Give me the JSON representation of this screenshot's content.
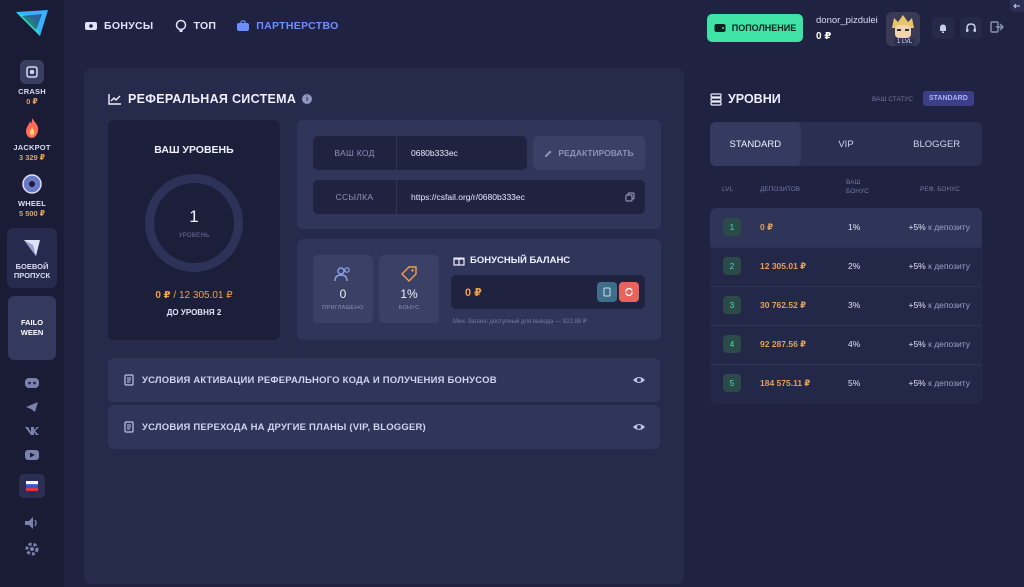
{
  "sidebar": {
    "games": [
      {
        "name": "CRASH",
        "value": "0 ₽"
      },
      {
        "name": "JACKPOT",
        "value": "3 329 ₽"
      },
      {
        "name": "WHEEL",
        "value": "5 500 ₽"
      }
    ],
    "battle_pass": "БОЕВОЙ ПРОПУСК",
    "event_line1": "FAILO",
    "event_line2": "WEEN",
    "socials": [
      "discord-icon",
      "telegram-icon",
      "vk-icon",
      "youtube-icon"
    ]
  },
  "topbar": {
    "nav": [
      {
        "label": "БОНУСЫ",
        "icon": "ticket-icon"
      },
      {
        "label": "ТОП",
        "icon": "trophy-icon"
      },
      {
        "label": "ПАРТНЕРСТВО",
        "icon": "briefcase-icon"
      }
    ],
    "deposit_label": "ПОПОЛНЕНИЕ",
    "username": "donor_pizdulei",
    "balance": "0 ₽",
    "avatar_level": "1 LVL"
  },
  "referral": {
    "title": "РЕФЕРАЛЬНАЯ СИСТЕМА",
    "your_level_title": "ВАШ УРОВЕНЬ",
    "level": "1",
    "level_label": "УРОВЕНЬ",
    "progress_current": "0 ₽",
    "progress_sep": " / ",
    "progress_target": "12 305.01 ₽",
    "next_level": "ДО УРОВНЯ 2",
    "code_label": "ВАШ КОД",
    "code_value": "0680b333ec",
    "edit_label": "РЕДАКТИРОВАТЬ",
    "link_label": "ССЫЛКА",
    "link_value": "https://csfail.org/r/0680b333ec",
    "invited_value": "0",
    "invited_label": "ПРИГЛАШЕНО",
    "bonus_pct_value": "1%",
    "bonus_pct_label": "БОНУС",
    "bonus_balance_title": "БОНУСНЫЙ БАЛАНС",
    "bonus_balance": "0 ₽",
    "bonus_note": "Мин. баланс доступный для вывода — 922.88 ₽",
    "accordion_1": "УСЛОВИЯ АКТИВАЦИИ РЕФЕРАЛЬНОГО КОДА И ПОЛУЧЕНИЯ БОНУСОВ",
    "accordion_2": "УСЛОВИЯ ПЕРЕХОДА НА ДРУГИЕ ПЛАНЫ (VIP, BLOGGER)"
  },
  "levels": {
    "title": "УРОВНИ",
    "status_label": "ВАШ СТАТУС",
    "status_badge": "STANDARD",
    "tabs": [
      "STANDARD",
      "VIP",
      "BLOGGER"
    ],
    "head_lvl": "LVL",
    "head_deposits": "ДЕПОЗИТОВ",
    "head_bonus_1": "ВАШ",
    "head_bonus_2": "БОНУС",
    "head_ref": "РЕФ. БОНУС",
    "rows": [
      {
        "lvl": "1",
        "dep": "0 ₽",
        "pct": "1%",
        "ref": "+5%",
        "ref_k": "к депозиту"
      },
      {
        "lvl": "2",
        "dep": "12 305.01 ₽",
        "pct": "2%",
        "ref": "+5%",
        "ref_k": "к депозиту"
      },
      {
        "lvl": "3",
        "dep": "30 762.52 ₽",
        "pct": "3%",
        "ref": "+5%",
        "ref_k": "к депозиту"
      },
      {
        "lvl": "4",
        "dep": "92 287.56 ₽",
        "pct": "4%",
        "ref": "+5%",
        "ref_k": "к депозиту"
      },
      {
        "lvl": "5",
        "dep": "184 575.11 ₽",
        "pct": "5%",
        "ref": "+5%",
        "ref_k": "к депозиту"
      }
    ]
  },
  "colors": {
    "accent_green": "#3fe3a6",
    "accent_orange": "#f0a04b",
    "accent_blue": "#6e8fff"
  }
}
